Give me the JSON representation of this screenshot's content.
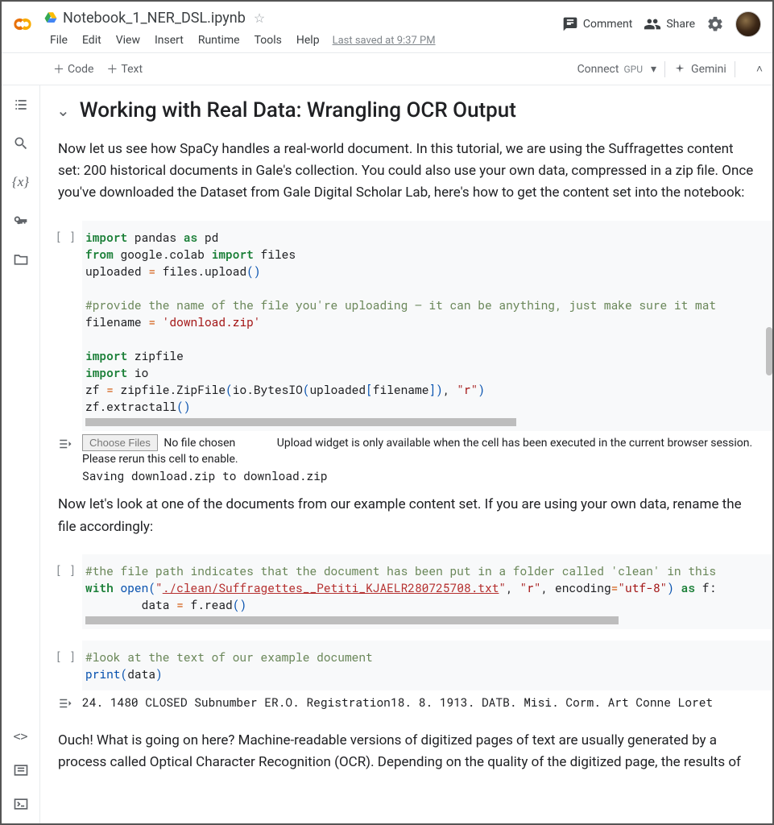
{
  "doc": {
    "title": "Notebook_1_NER_DSL.ipynb",
    "last_saved": "Last saved at 9:37 PM"
  },
  "menu": {
    "file": "File",
    "edit": "Edit",
    "view": "View",
    "insert": "Insert",
    "runtime": "Runtime",
    "tools": "Tools",
    "help": "Help"
  },
  "header_actions": {
    "comment": "Comment",
    "share": "Share"
  },
  "toolbar": {
    "code_label": "Code",
    "text_label": "Text",
    "connect": "Connect",
    "gpu": "GPU",
    "gemini": "Gemini"
  },
  "section": {
    "title": "Working with Real Data: Wrangling OCR Output"
  },
  "text1": "Now let us see how SpaCy handles a real-world document. In this tutorial, we are using the Suffragettes content set: 200 historical documents in Gale's collection. You could also use your own data, compressed in a zip file. Once you've downloaded the Dataset from Gale Digital Scholar Lab, here's how to get the content set into the notebook:",
  "cell1": {
    "prompt": "[ ]",
    "code": {
      "l1a": "import",
      "l1b": " pandas ",
      "l1c": "as",
      "l1d": " pd",
      "l2a": "from",
      "l2b": " google.colab ",
      "l2c": "import",
      "l2d": " files",
      "l3a": "uploaded ",
      "l3b": "=",
      "l3c": " files.upload",
      "l3d": "()",
      "l5": "#provide the name of the file you're uploading — it can be anything, just make sure it mat",
      "l6a": "filename ",
      "l6b": "=",
      "l6c": " ",
      "l6d": "'download.zip'",
      "l8a": "import",
      "l8b": " zipfile",
      "l9a": "import",
      "l9b": " io",
      "l10a": "zf ",
      "l10b": "=",
      "l10c": " zipfile.ZipFile",
      "l10d": "(",
      "l10e": "io.BytesIO",
      "l10f": "(",
      "l10g": "uploaded",
      "l10h": "[",
      "l10i": "filename",
      "l10j": "])",
      "l10k": ", ",
      "l10l": "\"r\"",
      "l10m": ")",
      "l11a": "zf.extractall",
      "l11b": "()"
    },
    "output": {
      "choose": "Choose Files",
      "nofile": "No file chosen",
      "msg": "Upload widget is only available when the cell has been executed in the current browser session. Please rerun this cell to enable.",
      "saving": "Saving download.zip to download.zip"
    }
  },
  "text2": "Now let's look at one of the documents from our example content set. If you are using your own data, rename the file accordingly:",
  "cell2": {
    "prompt": "[ ]",
    "code": {
      "l1": "#the file path indicates that the document has been put in a folder called 'clean' in this ",
      "l2a": "with",
      "l2b": " open",
      "l2c": "(",
      "l2d": "\"",
      "l2e": "./clean/Suffragettes__Petiti_KJAELR280725708.txt",
      "l2f": "\"",
      "l2g": ", ",
      "l2h": "\"r\"",
      "l2i": ", encoding",
      "l2j": "=",
      "l2k": "\"utf-8\"",
      "l2l": ")",
      "l2m": " as",
      "l2n": " f:",
      "l3a": "        data ",
      "l3b": "=",
      "l3c": " f.read",
      "l3d": "()"
    }
  },
  "cell3": {
    "prompt": "[ ]",
    "code": {
      "l1": "#look at the text of our example document",
      "l2a": "print",
      "l2b": "(",
      "l2c": "data",
      "l2d": ")"
    },
    "output": "24. 1480 CLOSED Subnumber ER.O. Registration18. 8. 1913. DATB. Misi. Corm. Art Conne Loret"
  },
  "text3": "Ouch! What is going on here? Machine-readable versions of digitized pages of text are usually generated by a process called Optical Character Recognition (OCR). Depending on the quality of the digitized page, the results of"
}
